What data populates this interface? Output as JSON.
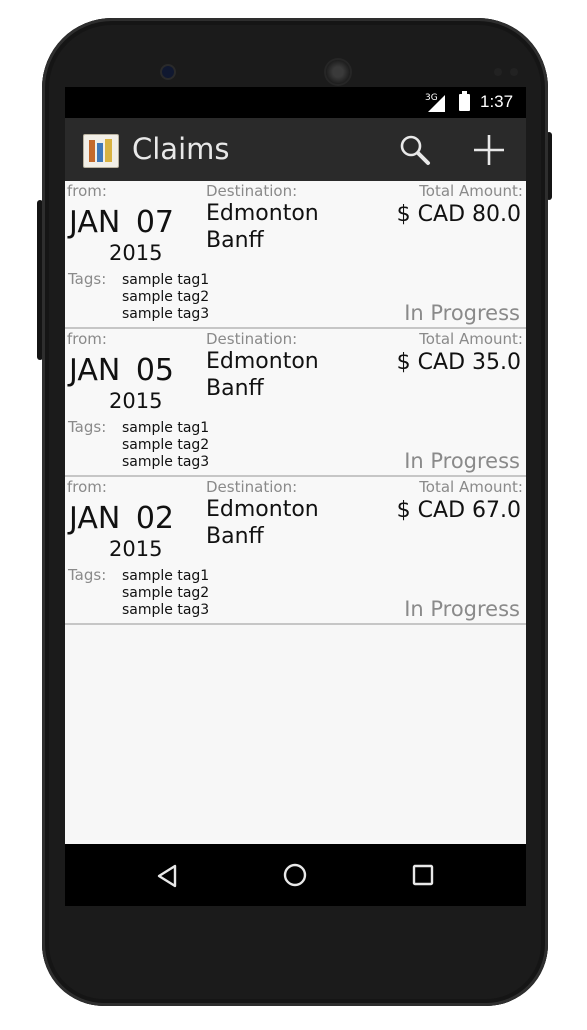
{
  "status_bar": {
    "network": "3G",
    "time": "1:37"
  },
  "action_bar": {
    "title": "Claims",
    "icons": [
      "app-logo-icon",
      "search-icon",
      "add-icon"
    ]
  },
  "labels": {
    "from": "from:",
    "destination": "Destination:",
    "total_amount": "Total Amount:",
    "tags": "Tags:"
  },
  "claims": [
    {
      "date_md": "JAN 07",
      "year": "2015",
      "destinations": [
        "Edmonton",
        "Banff"
      ],
      "amount": "$ CAD 80.0",
      "tags": [
        "sample tag1",
        "sample tag2",
        "sample tag3"
      ],
      "status": "In Progress"
    },
    {
      "date_md": "JAN 05",
      "year": "2015",
      "destinations": [
        "Edmonton",
        "Banff"
      ],
      "amount": "$ CAD 35.0",
      "tags": [
        "sample tag1",
        "sample tag2",
        "sample tag3"
      ],
      "status": "In Progress"
    },
    {
      "date_md": "JAN 02",
      "year": "2015",
      "destinations": [
        "Edmonton",
        "Banff"
      ],
      "amount": "$ CAD 67.0",
      "tags": [
        "sample tag1",
        "sample tag2",
        "sample tag3"
      ],
      "status": "In Progress"
    }
  ],
  "nav_bar": {
    "icons": [
      "back-icon",
      "home-icon",
      "recent-apps-icon"
    ]
  },
  "colors": {
    "action_bar": "#2a2a2a",
    "list_background": "#f8f8f8",
    "muted_text": "#8a8a8a",
    "divider": "#c6c6c6"
  }
}
